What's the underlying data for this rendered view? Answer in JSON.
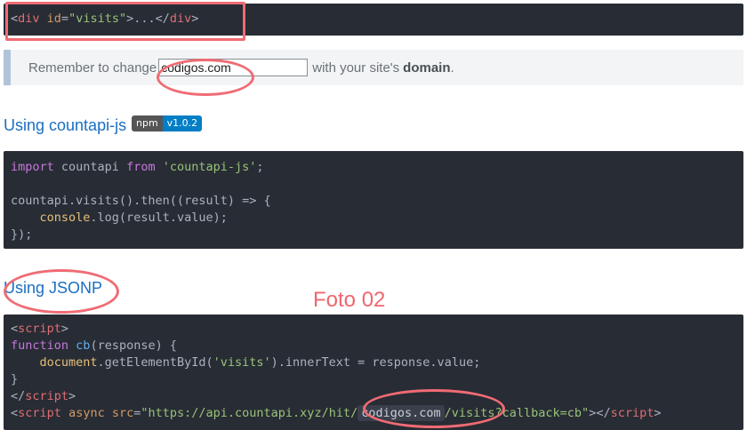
{
  "snippet_div": {
    "open_tag": "div",
    "attr": "id",
    "value": "\"visits\"",
    "ellipsis": "...",
    "close_tag": "div"
  },
  "notice": {
    "before": "Remember to change",
    "input_value": "codigos.com",
    "after": "with your site's",
    "bold": "domain",
    "period": "."
  },
  "section1": {
    "title": "Using countapi-js",
    "badge_left": "npm",
    "badge_right": "v1.0.2"
  },
  "code_js": {
    "import": "import",
    "module_var": " countapi ",
    "from": "from",
    "module": "'countapi-js'",
    "semi": ";",
    "line3_a": "countapi.visits().then((result) => {",
    "console": "console",
    "line4_b": ".log(result.value);",
    "line5": "});"
  },
  "section2": {
    "title": "Using JSONP"
  },
  "annotation": {
    "label": "Foto 02",
    "color": "#f06b74"
  },
  "code_jsonp": {
    "script": "script",
    "function": "function",
    "cb": "cb",
    "args": "(response) {",
    "document": "document",
    "getel": ".getElementById(",
    "visits_str": "'visits'",
    "rest": ").innerText = response.value;",
    "brace": "}",
    "async": "async",
    "src": "src",
    "url_a": "\"https://api.countapi.xyz/hit/",
    "domain": "codigos.com",
    "url_b": "/visits?callback=cb\""
  },
  "colors": {
    "code_bg": "#282c34",
    "heading": "#1a6ec2",
    "badge_npm": "#555555",
    "badge_version": "#007ec6"
  }
}
